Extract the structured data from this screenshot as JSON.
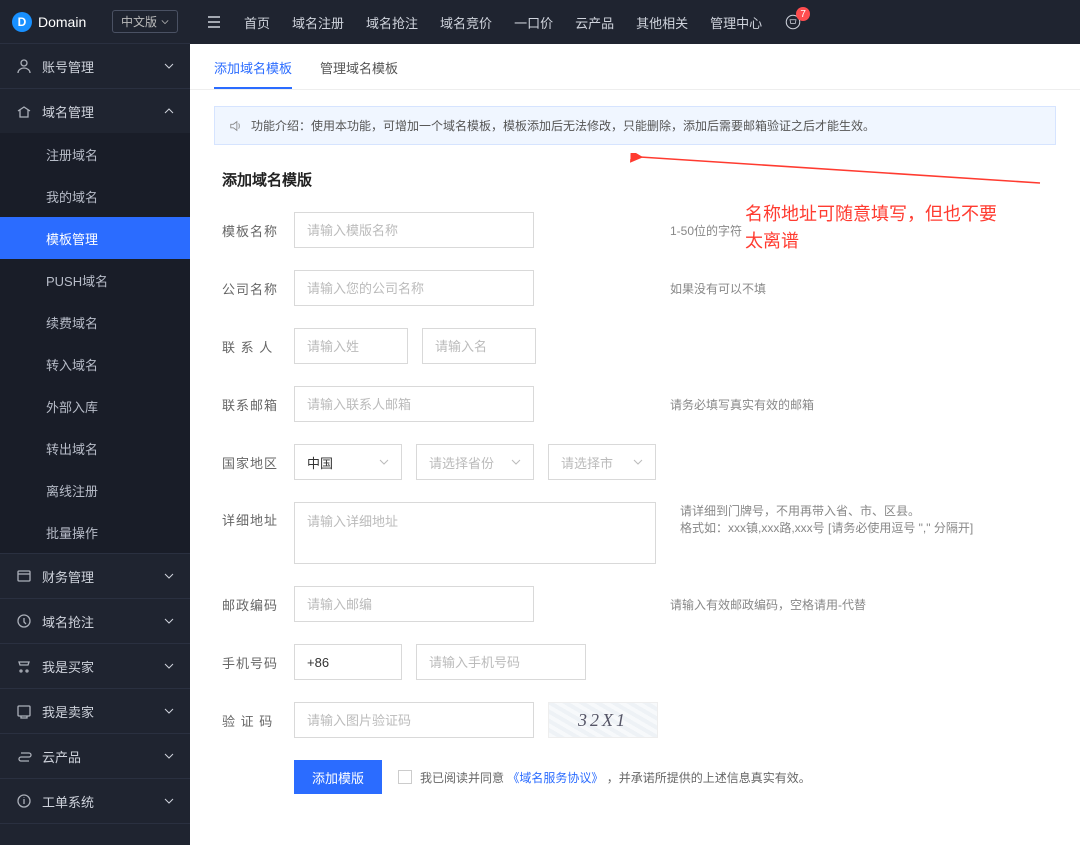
{
  "brand": {
    "logo": "D",
    "name": "Domain",
    "lang": "中文版"
  },
  "topnav": {
    "items": [
      "首页",
      "域名注册",
      "域名抢注",
      "域名竞价",
      "一口价",
      "云产品",
      "其他相关",
      "管理中心"
    ],
    "cart_badge": "7"
  },
  "sidebar": {
    "groups": [
      {
        "label": "账号管理",
        "expanded": false
      },
      {
        "label": "域名管理",
        "expanded": true,
        "items": [
          "注册域名",
          "我的域名",
          "模板管理",
          "PUSH域名",
          "续费域名",
          "转入域名",
          "外部入库",
          "转出域名",
          "离线注册",
          "批量操作"
        ],
        "active_index": 2
      },
      {
        "label": "财务管理",
        "expanded": false
      },
      {
        "label": "域名抢注",
        "expanded": false
      },
      {
        "label": "我是买家",
        "expanded": false
      },
      {
        "label": "我是卖家",
        "expanded": false
      },
      {
        "label": "云产品",
        "expanded": false
      },
      {
        "label": "工单系统",
        "expanded": false
      }
    ]
  },
  "tabs": {
    "items": [
      "添加域名模板",
      "管理域名模板"
    ],
    "active": 0
  },
  "notice": "功能介绍：使用本功能，可增加一个域名模板，模板添加后无法修改，只能删除，添加后需要邮箱验证之后才能生效。",
  "form": {
    "title": "添加域名模版",
    "template_name": {
      "label": "模板名称",
      "placeholder": "请输入模版名称",
      "hint": "1-50位的字符"
    },
    "company": {
      "label": "公司名称",
      "placeholder": "请输入您的公司名称",
      "hint": "如果没有可以不填"
    },
    "contact": {
      "label": "联 系 人",
      "ph_last": "请输入姓",
      "ph_first": "请输入名"
    },
    "email": {
      "label": "联系邮箱",
      "placeholder": "请输入联系人邮箱",
      "hint": "请务必填写真实有效的邮箱"
    },
    "region": {
      "label": "国家地区",
      "country": "中国",
      "province_ph": "请选择省份",
      "city_ph": "请选择市"
    },
    "address": {
      "label": "详细地址",
      "placeholder": "请输入详细地址",
      "hint": "请详细到门牌号，不用再带入省、市、区县。\n格式如：xxx镇,xxx路,xxx号 [请务必使用逗号 \",\" 分隔开]"
    },
    "postcode": {
      "label": "邮政编码",
      "placeholder": "请输入邮编",
      "hint": "请输入有效邮政编码，空格请用-代替"
    },
    "phone": {
      "label": "手机号码",
      "prefix": "+86",
      "placeholder": "请输入手机号码"
    },
    "captcha": {
      "label": "验 证 码",
      "placeholder": "请输入图片验证码",
      "value": "32X1"
    },
    "submit": "添加模版",
    "agree_pre": "我已阅读并同意",
    "agree_link": "《域名服务协议》",
    "agree_post": "，并承诺所提供的上述信息真实有效。"
  },
  "annotation": "名称地址可随意填写，但也不要\n太离谱"
}
